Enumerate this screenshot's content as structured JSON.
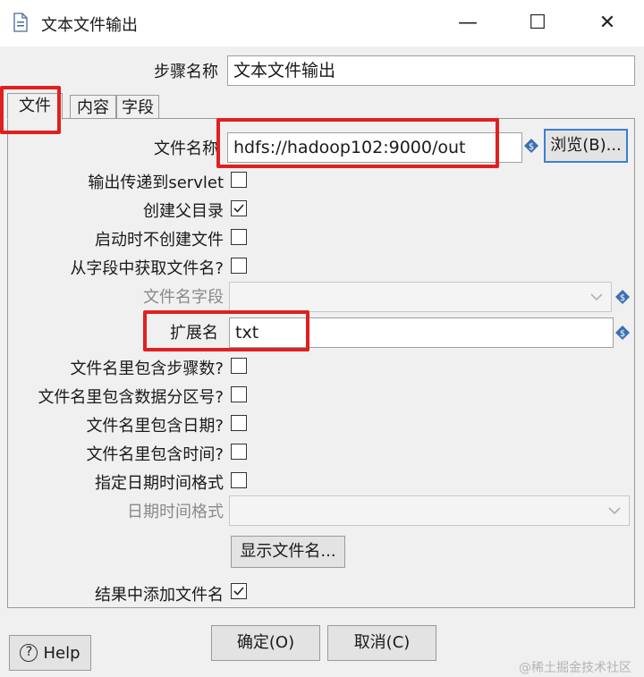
{
  "window": {
    "title": "文本文件输出",
    "minimize": "—",
    "maximize": "☐",
    "close": "✕"
  },
  "step_name": {
    "label": "步骤名称",
    "value": "文本文件输出"
  },
  "tabs": [
    {
      "label": "文件"
    },
    {
      "label": "内容"
    },
    {
      "label": "字段"
    }
  ],
  "file": {
    "filename_label": "文件名称",
    "filename_value": "hdfs://hadoop102:9000/out",
    "browse_label": "浏览(B)...",
    "servlet_label": "输出传递到servlet",
    "create_parent_label": "创建父目录",
    "no_create_start_label": "启动时不创建文件",
    "from_field_label": "从字段中获取文件名?",
    "filename_field_label": "文件名字段",
    "ext_label": "扩展名",
    "ext_value": "txt",
    "include_step_label": "文件名里包含步骤数?",
    "include_partition_label": "文件名里包含数据分区号?",
    "include_date_label": "文件名里包含日期?",
    "include_time_label": "文件名里包含时间?",
    "specify_datetime_label": "指定日期时间格式",
    "datetime_format_label": "日期时间格式",
    "show_filename_label": "显示文件名...",
    "add_to_result_label": "结果中添加文件名"
  },
  "buttons": {
    "help": "Help",
    "ok": "确定(O)",
    "cancel": "取消(C)"
  },
  "watermark": "@稀土掘金技术社区",
  "colors": {
    "highlight": "#e02020",
    "dialog_bg": "#f0f0f0",
    "browse_border": "#3c7fd0"
  }
}
